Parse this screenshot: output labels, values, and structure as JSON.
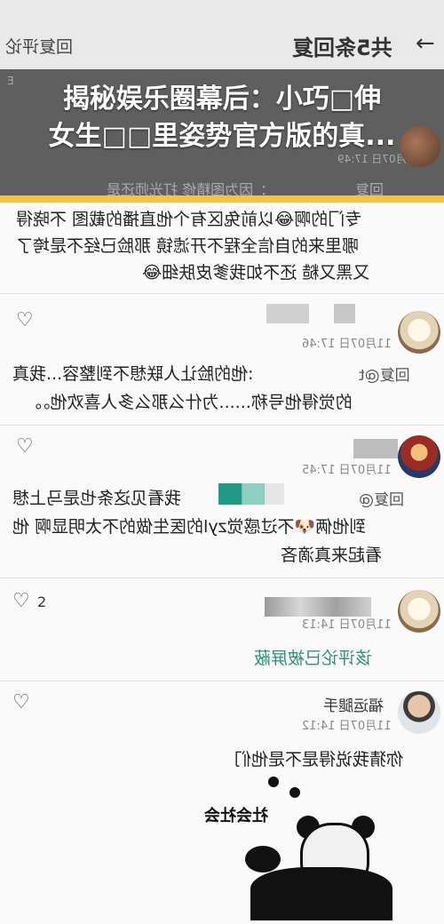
{
  "header": {
    "reply_label": "回复评论",
    "count_label": "共5条回复",
    "back_icon": "arrow-icon"
  },
  "overlay": {
    "title_line1": "揭秘娱乐圈幕后：小巧□伸",
    "title_line2": "女生□□里姿势官方版的真...",
    "bg_reply": "回复",
    "bg_snippet": "：因为图精修 打光师还是",
    "bg_time": "11月07日 17:49",
    "bg_misc": "E"
  },
  "comments": [
    {
      "text_lines": [
        "专门的啊😂以前兔区有个他直播的截图 不晓得",
        "哪里来的自信全程不开滤镜 那脸已经不是垮了",
        "又黑又糙 还不如我爹皮肤细😂"
      ]
    },
    {
      "time": "11月07日 17:46",
      "reply_label": "回复@t",
      "text_lines": [
        ":他的脸让人联想不到整容...我真",
        "的觉得他号称......为什么那么多人喜欢他。。"
      ]
    },
    {
      "time": "11月07日 17:45",
      "reply_label": "回复@",
      "text_lines": [
        "我看见这条也是马上想",
        "到他俩🐶不过感觉zyl的医生做的不太明显啊 他",
        "看起来真滴吝"
      ]
    },
    {
      "time": "11月07日 14:13",
      "like_count": "2",
      "blocked_text": "该评论已被屏蔽"
    },
    {
      "username": "福运腿手",
      "time": "11月07日 14:12",
      "text_lines": [
        "你猜我说得是不是他们"
      ],
      "sticker_caption": "社会社会"
    }
  ],
  "colors": {
    "accent_yellow": "#f5c242",
    "blocked_green": "#2e8f7a"
  }
}
